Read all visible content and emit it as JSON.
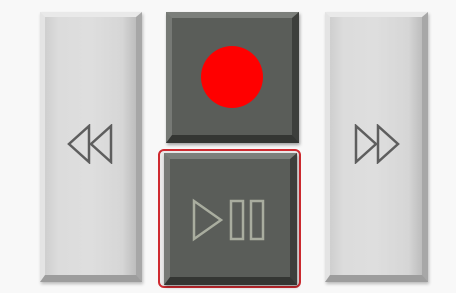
{
  "controls": {
    "rewind": {
      "icon": "rewind-icon",
      "stroke": "#5e5e5e"
    },
    "record": {
      "icon": "record-icon",
      "color": "#ff0000"
    },
    "play_pause": {
      "icon": "play-pause-icon",
      "stroke": "#a9ad9f",
      "selected": true,
      "highlight": "#d9262c"
    },
    "fast_forward": {
      "icon": "fast-forward-icon",
      "stroke": "#5e5e5e"
    }
  },
  "colors": {
    "dark_button": "#5a5d59",
    "light_button": "#dedede",
    "background": "#f8f8f8"
  }
}
